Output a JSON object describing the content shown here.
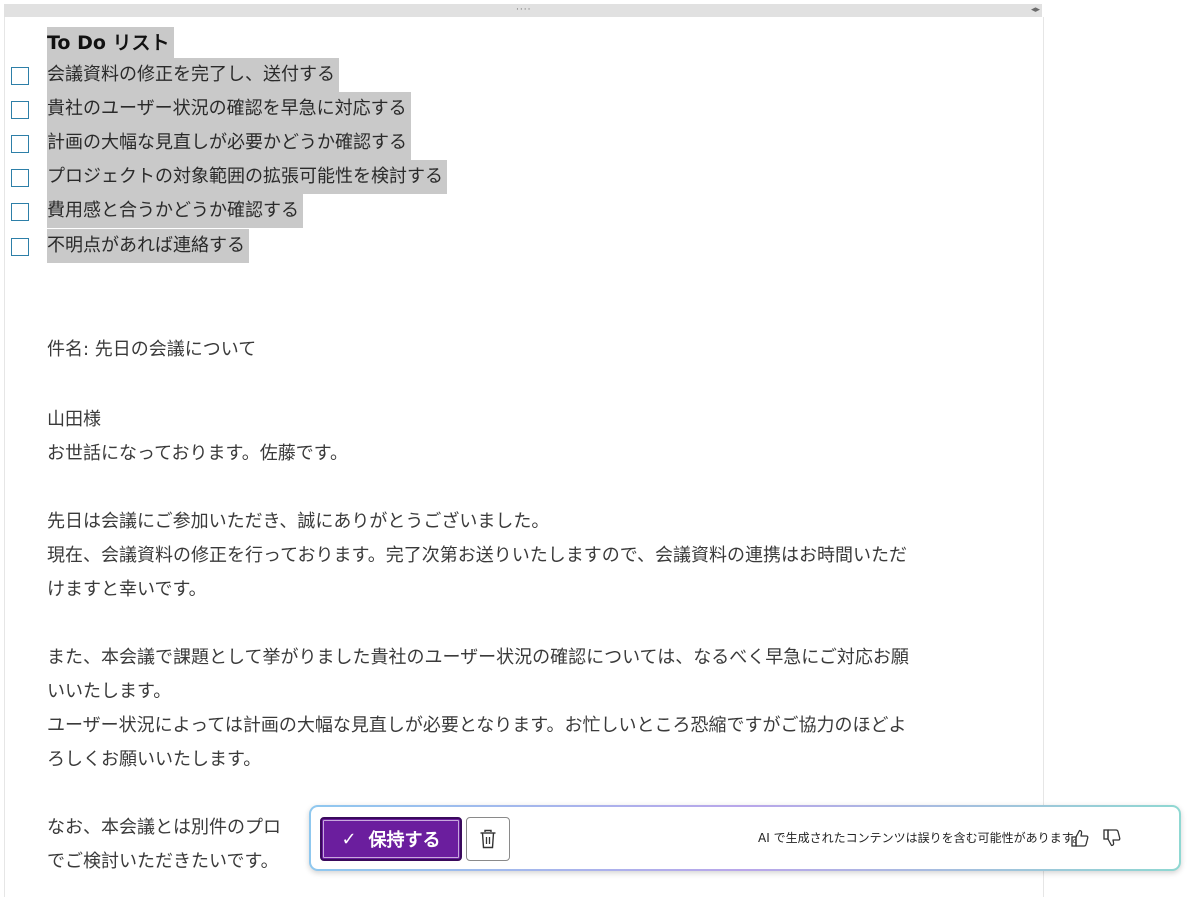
{
  "document": {
    "todo_title": "To Do リスト",
    "todo_items": [
      {
        "text": "会議資料の修正を完了し、送付する",
        "checked": false
      },
      {
        "text": "貴社のユーザー状況の確認を早急に対応する",
        "checked": false
      },
      {
        "text": "計画の大幅な見直しが必要かどうか確認する",
        "checked": false
      },
      {
        "text": "プロジェクトの対象範囲の拡張可能性を検討する",
        "checked": false
      },
      {
        "text": "費用感と合うかどうか確認する",
        "checked": false
      },
      {
        "text": "不明点があれば連絡する",
        "checked": false
      }
    ],
    "lines": [
      "件名: 先日の会議について",
      "山田様",
      "お世話になっております。佐藤です。",
      "先日は会議にご参加いただき、誠にありがとうございました。",
      "現在、会議資料の修正を行っております。完了次第お送りいたしますので、会議資料の連携はお時間いただ",
      "けますと幸いです。",
      "また、本会議で課題として挙がりました貴社のユーザー状況の確認については、なるべく早急にご対応お願",
      "いいたします。",
      "ユーザー状況によっては計画の大幅な見直しが必要となります。お忙しいところ恐縮ですがご協力のほどよ",
      "ろしくお願いいたします。",
      "なお、本会議とは別件のプロ",
      "でご検討いただきたいです。"
    ]
  },
  "ai_bar": {
    "keep_label": "保持する",
    "disclaimer": "AI で生成されたコンテンツは誤りを含む可能性があります。",
    "accent_color": "#6b1e9e"
  },
  "icons": {
    "keep": "check-icon",
    "discard": "trash-icon",
    "like": "thumbs-up-icon",
    "dislike": "thumbs-down-icon",
    "drag": "drag-handle-icon",
    "scroll": "scroll-arrows-icon"
  }
}
